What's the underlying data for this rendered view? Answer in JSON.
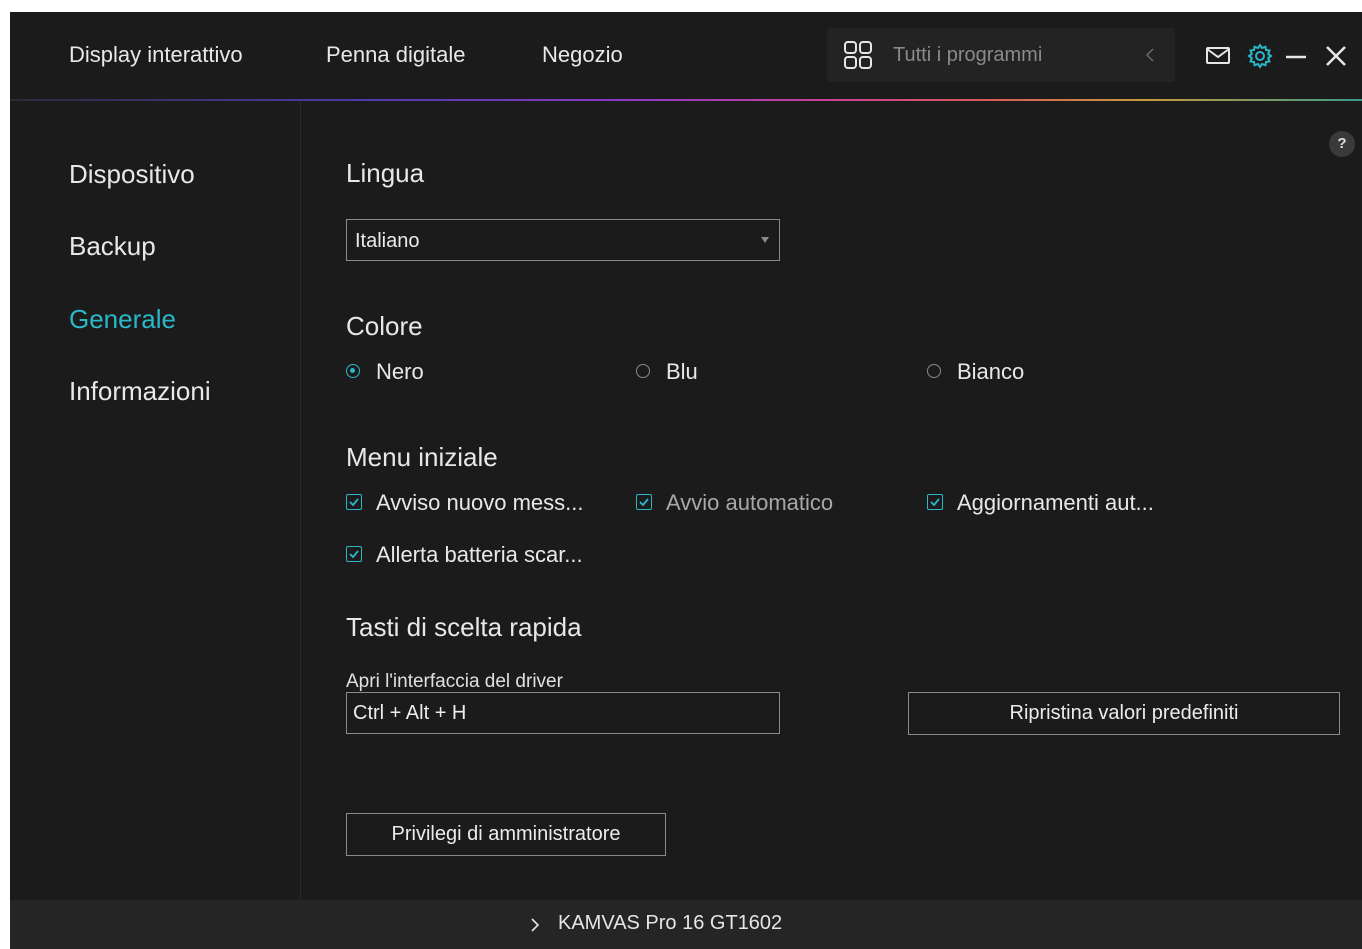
{
  "topbar": {
    "nav": [
      "Display interattivo",
      "Penna digitale",
      "Negozio"
    ],
    "search_placeholder": "Tutti i programmi",
    "accent": "#2ab7c8"
  },
  "sidebar": {
    "items": [
      {
        "label": "Dispositivo",
        "active": false
      },
      {
        "label": "Backup",
        "active": false
      },
      {
        "label": "Generale",
        "active": true
      },
      {
        "label": "Informazioni",
        "active": false
      }
    ]
  },
  "main": {
    "help": "?",
    "language": {
      "title": "Lingua",
      "selected": "Italiano"
    },
    "color": {
      "title": "Colore",
      "options": [
        {
          "label": "Nero",
          "selected": true
        },
        {
          "label": "Blu",
          "selected": false
        },
        {
          "label": "Bianco",
          "selected": false
        }
      ]
    },
    "startup": {
      "title": "Menu iniziale",
      "options": [
        {
          "label": "Avviso nuovo mess...",
          "checked": true
        },
        {
          "label": "Avvio automatico",
          "checked": true
        },
        {
          "label": "Aggiornamenti aut...",
          "checked": true
        },
        {
          "label": "Allerta batteria scar...",
          "checked": true
        }
      ]
    },
    "hotkeys": {
      "title": "Tasti di scelta rapida",
      "label": "Apri l'interfaccia del driver",
      "value": "Ctrl + Alt + H",
      "reset_label": "Ripristina valori predefiniti"
    },
    "admin_label": "Privilegi di amministratore"
  },
  "footer": {
    "device": "KAMVAS Pro 16 GT1602"
  }
}
